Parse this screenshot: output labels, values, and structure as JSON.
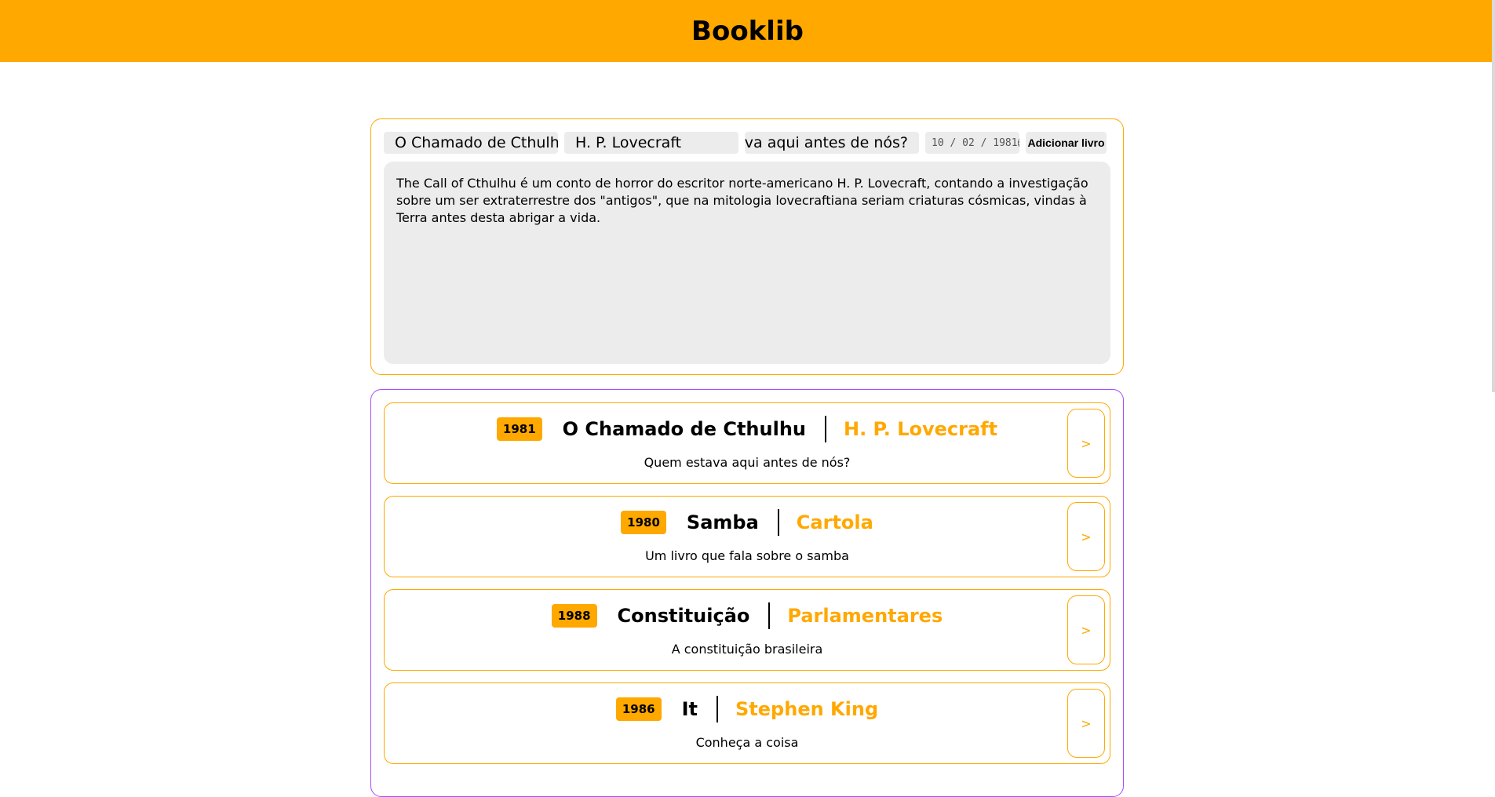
{
  "app": {
    "title": "Booklib"
  },
  "form": {
    "title_value": "O Chamado de Cthulhu",
    "author_value": "H. P. Lovecraft",
    "subtitle_value": "stava aqui antes de nós?",
    "date_value": "10 / 02 / 1981",
    "add_button_label": "Adicionar livro",
    "description_value": "The Call of Cthulhu é um conto de horror do escritor norte-americano H. P. Lovecraft, contando a investigação sobre um ser extraterrestre dos \"antigos\", que na mitologia lovecraftiana seriam criaturas cósmicas, vindas à Terra antes desta abrigar a vida."
  },
  "books": [
    {
      "year": "1981",
      "title": "O Chamado de Cthulhu",
      "author": "H. P. Lovecraft",
      "description": "Quem estava aqui antes de nós?",
      "open_label": ">"
    },
    {
      "year": "1980",
      "title": "Samba",
      "author": "Cartola",
      "description": "Um livro que fala sobre o samba",
      "open_label": ">"
    },
    {
      "year": "1988",
      "title": "Constituição",
      "author": "Parlamentares",
      "description": "A constituição brasileira",
      "open_label": ">"
    },
    {
      "year": "1986",
      "title": "It",
      "author": "Stephen King",
      "description": "Conheça a coisa",
      "open_label": ">"
    }
  ],
  "colors": {
    "accent": "#ffa800",
    "list_border": "#a64dff",
    "input_bg": "#ececec"
  }
}
